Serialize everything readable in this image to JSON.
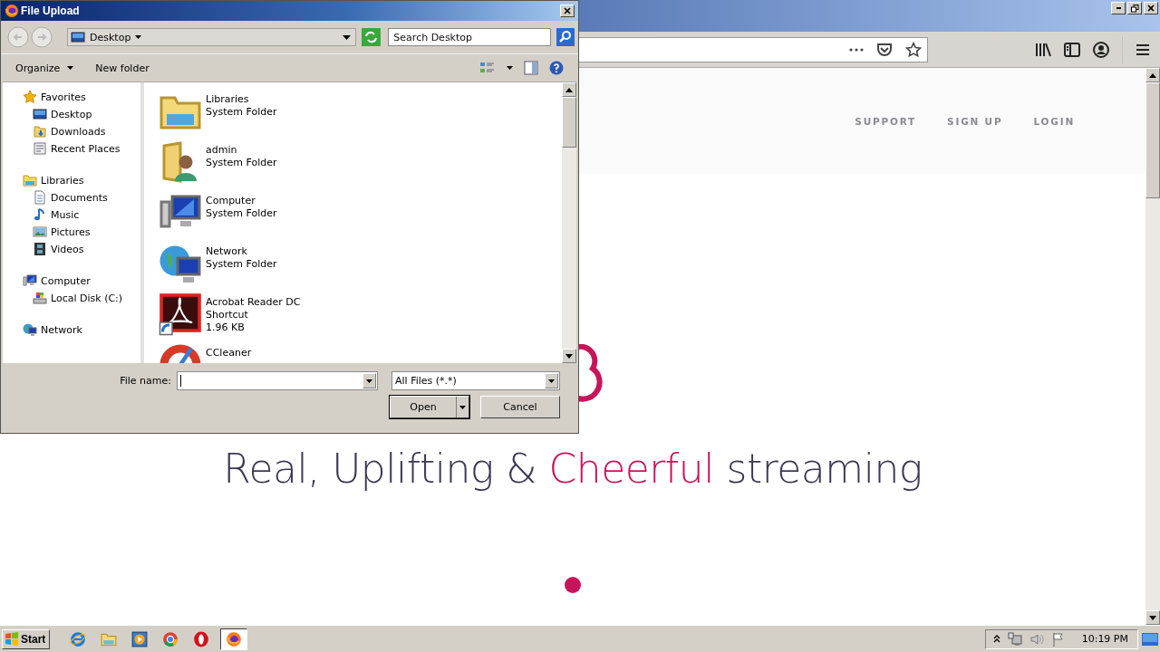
{
  "browser": {
    "nav_links": [
      "SUPPORT",
      "SIGN UP",
      "LOGIN"
    ],
    "headline": [
      {
        "text": "Real, Uplifting &",
        "accent": false
      },
      {
        "text": "Cheerful",
        "accent": true
      },
      {
        "text": "streaming",
        "accent": false
      }
    ]
  },
  "dialog": {
    "title": "File Upload",
    "location": "Desktop",
    "search": {
      "placeholder": "Search Desktop"
    },
    "toolbar": [
      "Organize",
      "New folder"
    ],
    "nav": [
      {
        "label": "Favorites",
        "children": [
          {
            "label": "Desktop"
          },
          {
            "label": "Downloads"
          },
          {
            "label": "Recent Places"
          }
        ]
      },
      {
        "label": "Libraries",
        "children": [
          {
            "label": "Documents"
          },
          {
            "label": "Music"
          },
          {
            "label": "Pictures"
          },
          {
            "label": "Videos"
          }
        ]
      },
      {
        "label": "Computer",
        "children": [
          {
            "label": "Local Disk (C:)"
          }
        ]
      },
      {
        "label": "Network"
      }
    ],
    "files": [
      {
        "name": "Libraries",
        "details": [
          "System Folder"
        ]
      },
      {
        "name": "admin",
        "details": [
          "System Folder"
        ]
      },
      {
        "name": "Computer",
        "details": [
          "System Folder"
        ]
      },
      {
        "name": "Network",
        "details": [
          "System Folder"
        ]
      },
      {
        "name": "Acrobat Reader DC",
        "details": [
          "Shortcut",
          "1.96 KB"
        ]
      },
      {
        "name": "CCleaner"
      }
    ],
    "file_name_label": "File name:",
    "file_type": "All Files (*.*)",
    "buttons": [
      {
        "label": "Open",
        "kind": "split"
      },
      {
        "label": "Cancel",
        "kind": "plain"
      }
    ]
  },
  "taskbar": {
    "start": "Start",
    "apps": [
      {
        "selected": false
      },
      {
        "selected": false
      },
      {
        "selected": false
      },
      {
        "selected": false
      },
      {
        "selected": false
      },
      {
        "selected": true
      }
    ],
    "clock": "10:19 PM"
  }
}
